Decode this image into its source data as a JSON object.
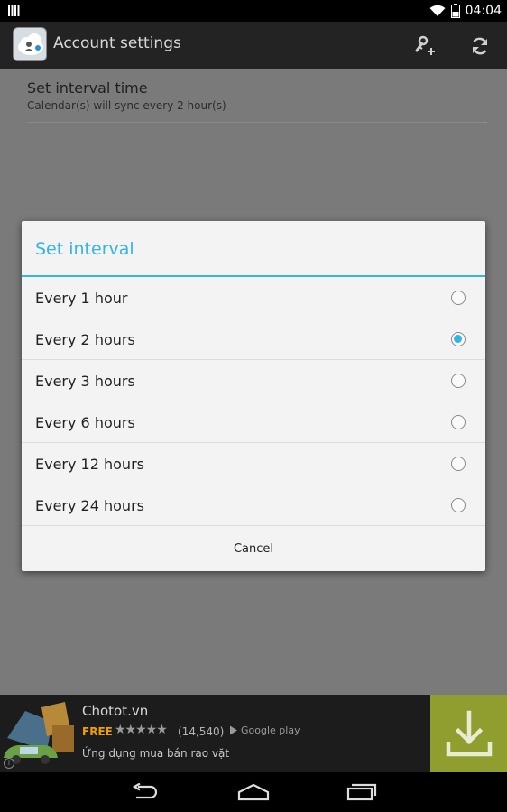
{
  "status_bar": {
    "time": "04:04"
  },
  "app_bar": {
    "title": "Account settings"
  },
  "preference": {
    "title": "Set interval time",
    "summary": "Calendar(s) will sync every 2 hour(s)"
  },
  "dialog": {
    "title": "Set interval",
    "options": [
      {
        "label": "Every 1 hour",
        "selected": false
      },
      {
        "label": "Every 2 hours",
        "selected": true
      },
      {
        "label": "Every 3 hours",
        "selected": false
      },
      {
        "label": "Every 6 hours",
        "selected": false
      },
      {
        "label": "Every 12 hours",
        "selected": false
      },
      {
        "label": "Every 24 hours",
        "selected": false
      }
    ],
    "cancel_label": "Cancel"
  },
  "ad": {
    "title": "Chotot.vn",
    "price": "FREE",
    "stars": "★★★★★",
    "rating_count": "(14,540)",
    "store": "Google play",
    "description": "Ứng dụng mua bán rao vặt"
  },
  "colors": {
    "accent": "#33b5e5",
    "download": "#8f9e2f"
  },
  "icons": [
    "notification-icon",
    "wifi-icon",
    "battery-icon",
    "add-account-icon",
    "sync-icon",
    "download-icon",
    "back-icon",
    "home-icon",
    "recents-icon",
    "info-icon"
  ]
}
